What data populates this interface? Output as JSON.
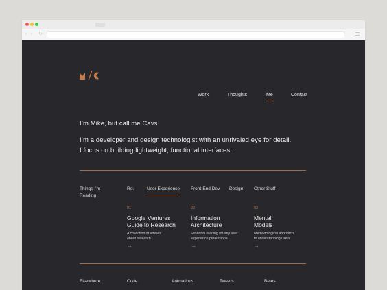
{
  "site": {
    "nav": {
      "work": "Work",
      "thoughts": "Thoughts",
      "me": "Me",
      "contact": "Contact"
    },
    "intro": {
      "greeting": "I’m Mike, but call me Cavs.",
      "line1": "I’m a developer and design technologist with an unrivaled eye for detail.",
      "line2": "I focus on building lightweight, functional interfaces."
    },
    "reading": {
      "label_line1": "Things I’m",
      "label_line2": "Reading",
      "re_label": "Re:",
      "filters": [
        "User Experience",
        "Front-End Dev",
        "Design",
        "Other Stuff"
      ],
      "active_filter": "User Experience",
      "cards": [
        {
          "num": "01",
          "title_line1": "Google Ventures",
          "title_line2": "Guide to Research",
          "desc_line1": "A collection of articles",
          "desc_line2": "about research",
          "arrow": "→"
        },
        {
          "num": "02",
          "title_line1": "Information",
          "title_line2": "Architecture",
          "desc_line1": "Essential reading for any user",
          "desc_line2": "experience professional",
          "arrow": "→"
        },
        {
          "num": "03",
          "title_line1": "Mental",
          "title_line2": "Models",
          "desc_line1": "Methodological approach",
          "desc_line2": "to understanding users",
          "arrow": "→"
        }
      ]
    },
    "footer": {
      "elsewhere": "Elsewhere",
      "links": [
        {
          "label": "Code",
          "icon": "github-icon"
        },
        {
          "label": "Animations",
          "icon": "dribbble-icon"
        },
        {
          "label": "Tweets",
          "icon": "twitter-icon"
        },
        {
          "label": "Beats",
          "icon": "soundcloud-icon"
        }
      ]
    },
    "colors": {
      "background": "#28282c",
      "accent": "#c47a4c",
      "text": "#ececec"
    }
  }
}
